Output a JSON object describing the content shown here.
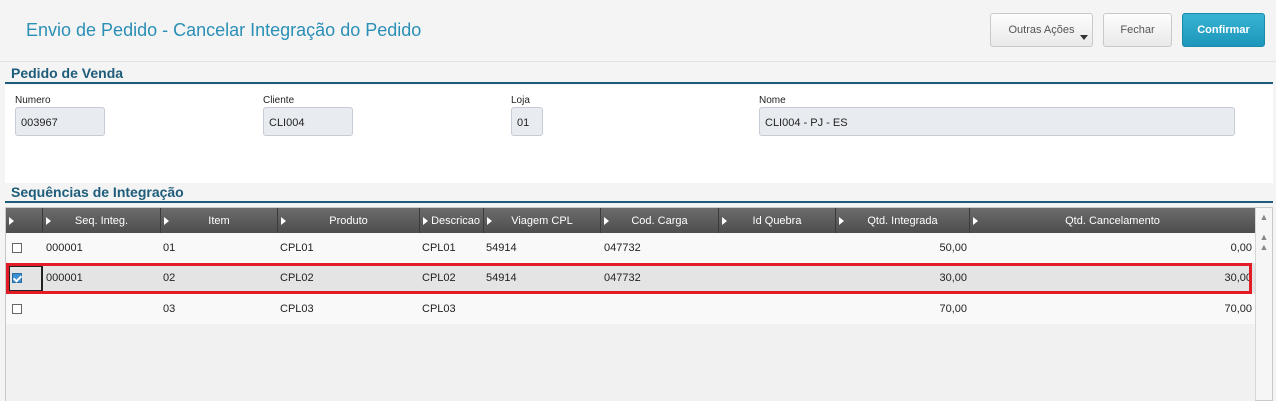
{
  "header": {
    "title": "Envio de Pedido - Cancelar Integração do Pedido",
    "buttons": {
      "outras_acoes": "Outras Ações",
      "fechar": "Fechar",
      "confirmar": "Confirmar"
    }
  },
  "pedido": {
    "section_title": "Pedido de Venda",
    "fields": {
      "numero": {
        "label": "Numero",
        "value": "003967"
      },
      "cliente": {
        "label": "Cliente",
        "value": "CLI004"
      },
      "loja": {
        "label": "Loja",
        "value": "01"
      },
      "nome": {
        "label": "Nome",
        "value": "CLI004 - PJ - ES"
      }
    }
  },
  "sequencias": {
    "section_title": "Sequências de Integração",
    "columns": [
      "Seq. Integ.",
      "Item",
      "Produto",
      "Descricao",
      "Viagem CPL",
      "Cod. Carga",
      "Id Quebra",
      "Qtd. Integrada",
      "Qtd. Cancelamento"
    ],
    "rows": [
      {
        "checked": false,
        "seq": "000001",
        "item": "01",
        "produto": "CPL01",
        "descricao": "CPL01",
        "viagem": "54914",
        "carga": "047732",
        "quebra": "",
        "qtd_integrada": "50,00",
        "qtd_cancelamento": "0,00"
      },
      {
        "checked": true,
        "seq": "000001",
        "item": "02",
        "produto": "CPL02",
        "descricao": "CPL02",
        "viagem": "54914",
        "carga": "047732",
        "quebra": "",
        "qtd_integrada": "30,00",
        "qtd_cancelamento": "30,00"
      },
      {
        "checked": false,
        "seq": "",
        "item": "03",
        "produto": "CPL03",
        "descricao": "CPL03",
        "viagem": "",
        "carga": "",
        "quebra": "",
        "qtd_integrada": "70,00",
        "qtd_cancelamento": "70,00"
      }
    ]
  },
  "icons": {
    "checkbox_checked": "checkbox-checked-icon",
    "checkbox_unchecked": "checkbox-unchecked-icon",
    "sort": "sort-triangle-icon",
    "dropdown": "chevron-down-icon",
    "scroll_top": "scroll-top-icon",
    "scroll_up": "scroll-up-icon"
  },
  "colors": {
    "title": "#2a8fb6",
    "section": "#1d5c7a",
    "primary_button": "#1c97bb",
    "highlight": "#e11c24"
  }
}
